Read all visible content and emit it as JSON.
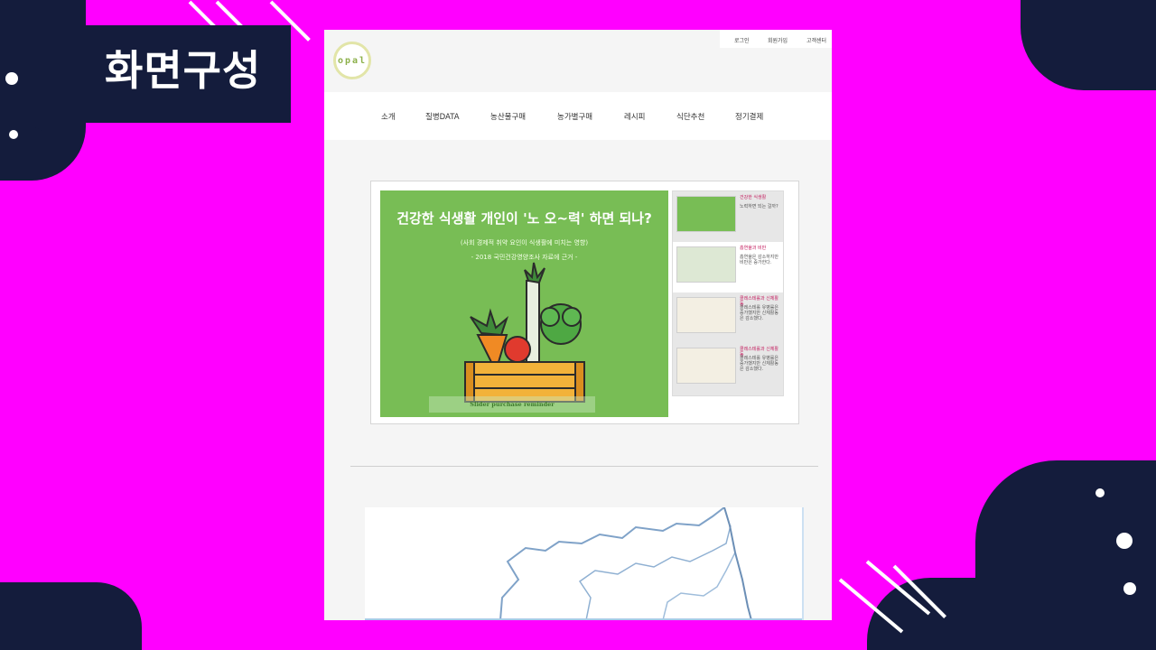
{
  "slide_title": "화면구성",
  "site": {
    "logo_text": "opal",
    "util_links": [
      "로그인",
      "회원가입",
      "고객센터"
    ],
    "nav_items": [
      "소개",
      "질병DATA",
      "농산물구매",
      "농가별구매",
      "레시피",
      "식단추천",
      "정기결제"
    ]
  },
  "slider": {
    "title": "건강한 식생활 개인이 '노 오~력' 하면 되나?",
    "subtitle1": "(사회 경제적 취약 요인이 식생활에 미치는 영향)",
    "subtitle2": "- 2018 국민건강영양조사 자료에 근거 -",
    "caption": "Slider purchase reminder",
    "thumbs": [
      {
        "title": "건강한 식생활",
        "desc": "노력하면 되는 걸까?"
      },
      {
        "title": "흡연율과 비만",
        "desc": "흡연율은 감소하지만 비만은 증가한다."
      },
      {
        "title": "콜레스테롤과 신체활동",
        "desc": "콜레스테롤 유병률은 증가했지만 신체활동은 감소했다."
      },
      {
        "title": "콜레스테롤과 신체활동",
        "desc": "콜레스테롤 유병률은 증가했지만 신체활동은 감소했다."
      }
    ]
  },
  "colors": {
    "background": "#ff00ff",
    "decor": "#141c3c",
    "hero_green": "#78bd55",
    "thumb_title": "#c2185b"
  }
}
